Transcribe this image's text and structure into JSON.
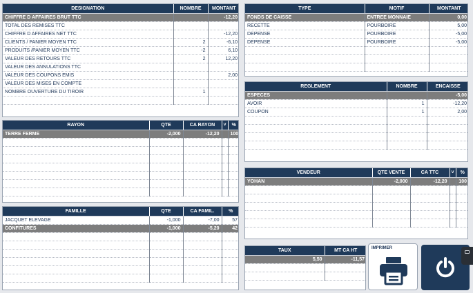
{
  "summary": {
    "headers": [
      "DESIGNATION",
      "NOMBRE",
      "MONTANT"
    ],
    "rows": [
      [
        "CHIFFRE D AFFAIRES BRUT TTC",
        "",
        "-12,20"
      ],
      [
        "TOTAL DES REMISES TTC",
        "",
        ""
      ],
      [
        "CHIFFRE D AFFAIRES NET TTC",
        "",
        "-12,20"
      ],
      [
        "CLIENTS / PANIER MOYEN TTC",
        "2",
        "-6,10"
      ],
      [
        "PRODUITS /PANIER MOYEN TTC",
        "-2",
        "6,10"
      ],
      [
        "VALEUR DES RETOURS TTC",
        "2",
        "12,20"
      ],
      [
        "VALEUR DES ANNULATIONS TTC",
        "",
        ""
      ],
      [
        "VALEUR DES COUPONS EMIS",
        "",
        "2,00"
      ],
      [
        "VALEUR DES MISES EN COMPTE",
        "",
        ""
      ],
      [
        "NOMBRE OUVERTURE DU TIROIR",
        "1",
        ""
      ],
      [
        "",
        "",
        ""
      ]
    ]
  },
  "rayon": {
    "headers": [
      "RAYON",
      "QTE",
      "CA  RAYON",
      "˅",
      "%"
    ],
    "rows": [
      [
        "TERRE FERME",
        "-2,000",
        "-12,20",
        "",
        "100"
      ],
      [
        "",
        "",
        "",
        "",
        ""
      ],
      [
        "",
        "",
        "",
        "",
        ""
      ],
      [
        "",
        "",
        "",
        "",
        ""
      ],
      [
        "",
        "",
        "",
        "",
        ""
      ],
      [
        "",
        "",
        "",
        "",
        ""
      ],
      [
        "",
        "",
        "",
        "",
        ""
      ],
      [
        "",
        "",
        "",
        "",
        ""
      ]
    ]
  },
  "famille": {
    "headers": [
      "FAMILLE",
      "QTE",
      "CA FAMIL.",
      "%"
    ],
    "rows": [
      [
        "JACQUET ELEVAGE",
        "-1,000",
        "-7,00",
        "57"
      ],
      [
        "CONFITURES",
        "-1,000",
        "-5,20",
        "42"
      ],
      [
        "",
        "",
        "",
        ""
      ],
      [
        "",
        "",
        "",
        ""
      ],
      [
        "",
        "",
        "",
        ""
      ],
      [
        "",
        "",
        "",
        ""
      ],
      [
        "",
        "",
        "",
        ""
      ],
      [
        "",
        "",
        "",
        ""
      ]
    ]
  },
  "cash": {
    "headers": [
      "TYPE",
      "MOTIF",
      "MONTANT"
    ],
    "rows": [
      [
        "FONDS DE CAISSE",
        "ENTREE MONNAIE",
        "0,00"
      ],
      [
        "RECETTE",
        "POURBOIRE",
        "5,00"
      ],
      [
        "DEPENSE",
        "POURBOIRE",
        "-5,00"
      ],
      [
        "DEPENSE",
        "POURBOIRE",
        "-5,00"
      ],
      [
        "",
        "",
        ""
      ],
      [
        "",
        "",
        ""
      ],
      [
        "",
        "",
        ""
      ]
    ]
  },
  "reglement": {
    "headers": [
      "REGLEMENT",
      "NOMBRE",
      "ENCAISSE"
    ],
    "rows": [
      [
        "ESPECES",
        "",
        "-5,00"
      ],
      [
        "AVOIR",
        "1",
        "-12,20"
      ],
      [
        "COUPON",
        "1",
        "2,00"
      ],
      [
        "",
        "",
        ""
      ],
      [
        "",
        "",
        ""
      ],
      [
        "",
        "",
        ""
      ],
      [
        "",
        "",
        ""
      ]
    ]
  },
  "vendeur": {
    "headers": [
      "VENDEUR",
      "QTE VENTE",
      "CA TTC",
      "˅",
      "%"
    ],
    "rows": [
      [
        "YOHAN",
        "-2,000",
        "-12,20",
        "",
        "100"
      ],
      [
        "",
        "",
        "",
        "",
        ""
      ],
      [
        "",
        "",
        "",
        "",
        ""
      ],
      [
        "",
        "",
        "",
        "",
        ""
      ],
      [
        "",
        "",
        "",
        "",
        ""
      ],
      [
        "",
        "",
        "",
        "",
        ""
      ]
    ]
  },
  "taux": {
    "headers": [
      "TAUX",
      "MT CA HT"
    ],
    "rows": [
      [
        "5,50",
        "-11,57"
      ],
      [
        "",
        ""
      ],
      [
        "",
        ""
      ]
    ]
  },
  "buttons": {
    "print_label": "IMPRIMER",
    "print_icon": "printer-icon",
    "power_icon": "power-icon"
  },
  "colors": {
    "header_bg": "#1f3a5a",
    "highlight_row": "#7d7d7d",
    "text": "#1d3557",
    "background": "#e6e8ec"
  }
}
